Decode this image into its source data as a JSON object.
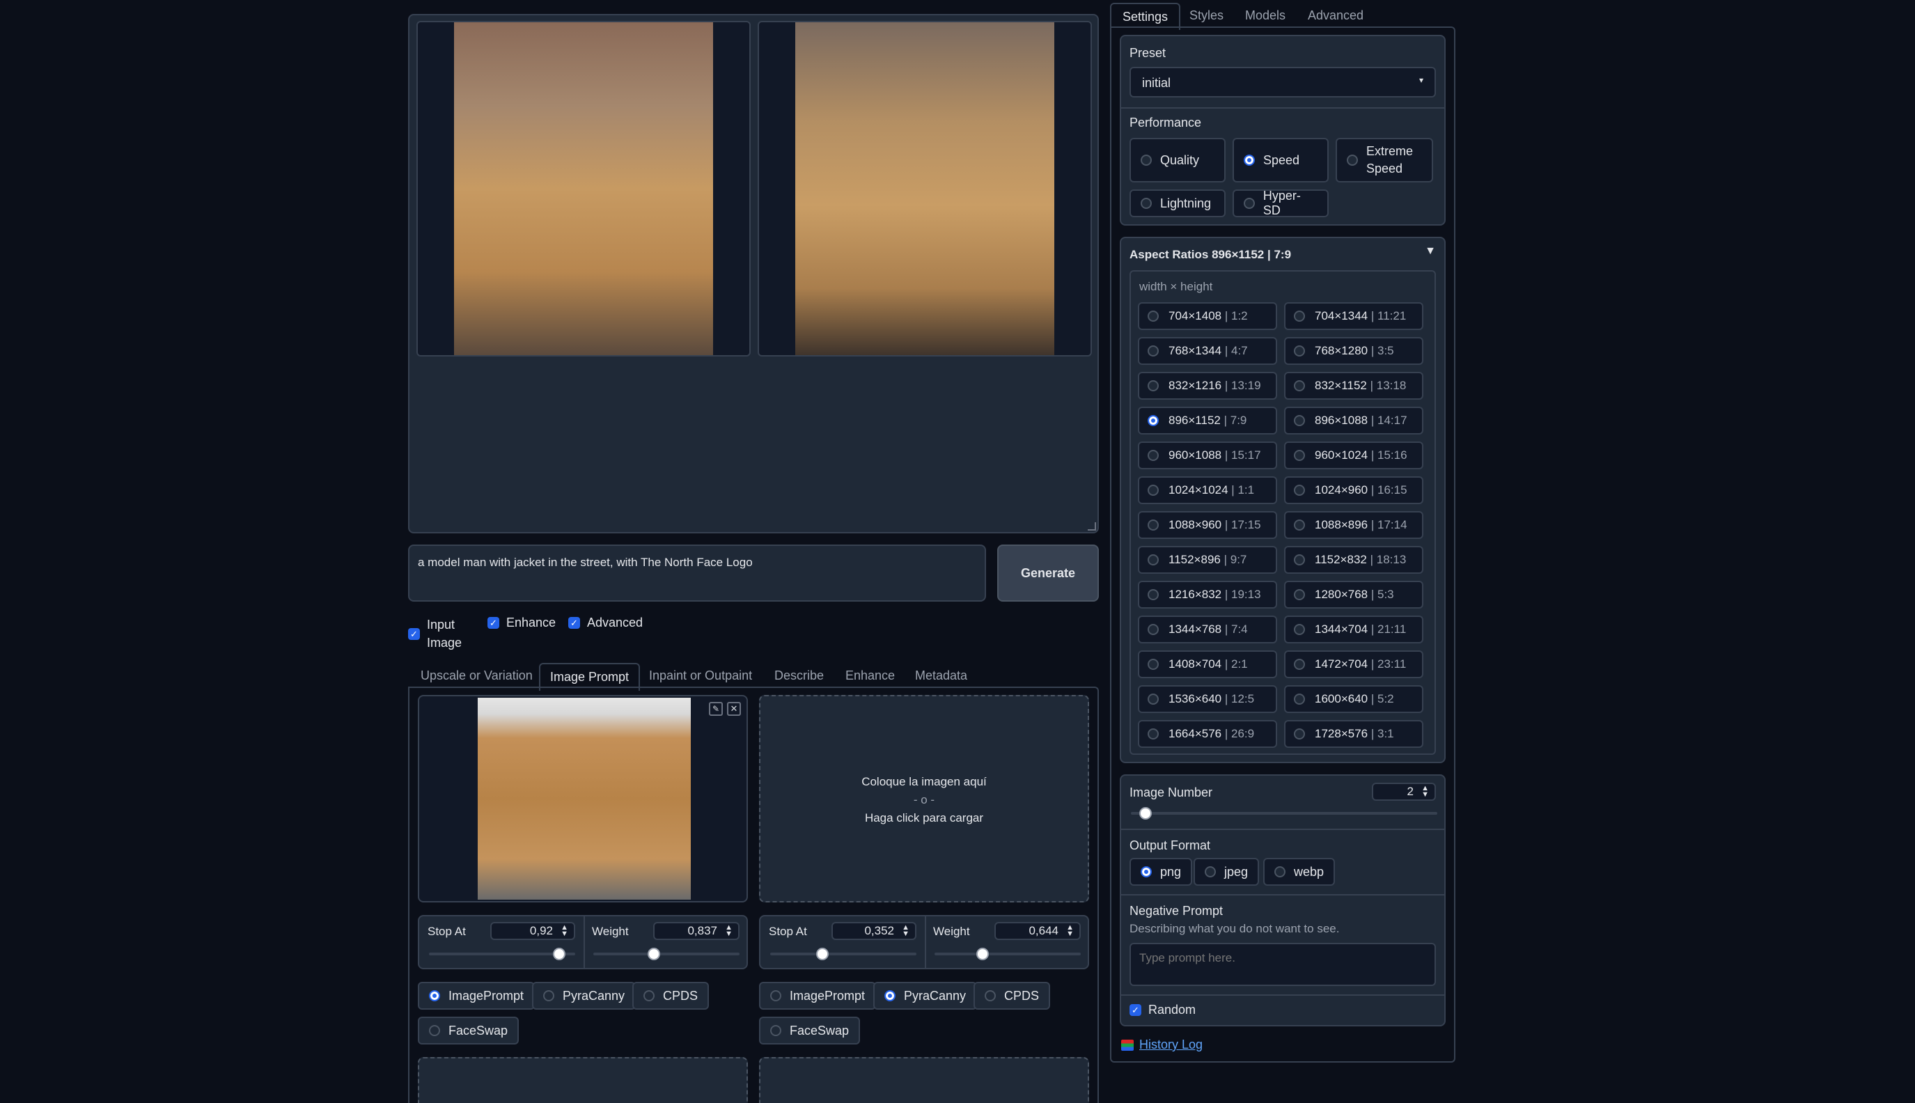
{
  "gallery": {
    "image1_alt": "",
    "image2_alt": ""
  },
  "prompt": {
    "value": "a  model man with jacket  in the street, with The North Face Logo",
    "generate_label": "Generate"
  },
  "toggles": {
    "input_image_line1": "Input",
    "input_image_line2": "Image",
    "enhance": "Enhance",
    "advanced": "Advanced"
  },
  "input_tabs": [
    "Upscale or Variation",
    "Image Prompt",
    "Inpaint or Outpaint",
    "Describe",
    "Enhance",
    "Metadata"
  ],
  "image_prompt": {
    "drop_line1": "Coloque la imagen aquí",
    "drop_line2": "- o -",
    "drop_line3": "Haga click para cargar",
    "slot1": {
      "stop_label": "Stop At",
      "stop_value": "0,92",
      "stop_fraction": 0.92,
      "weight_label": "Weight",
      "weight_value": "0,837",
      "weight_fraction": 0.4185
    },
    "slot2": {
      "stop_label": "Stop At",
      "stop_value": "0,352",
      "stop_fraction": 0.352,
      "weight_label": "Weight",
      "weight_value": "0,644",
      "weight_fraction": 0.322
    },
    "types": [
      "ImagePrompt",
      "PyraCanny",
      "CPDS",
      "FaceSwap"
    ],
    "slot1_selected": "ImagePrompt",
    "slot2_selected": "PyraCanny"
  },
  "settings_tabs": [
    "Settings",
    "Styles",
    "Models",
    "Advanced"
  ],
  "preset": {
    "label": "Preset",
    "value": "initial"
  },
  "performance": {
    "label": "Performance",
    "options": [
      "Quality",
      "Speed",
      "Extreme",
      "Speed",
      "Lightning",
      "Hyper-SD"
    ],
    "selected": "Speed"
  },
  "aspect": {
    "header": "Aspect Ratios 896×1152 | 7:9",
    "hint": "width × height",
    "options": [
      [
        "704×1408",
        "1:2"
      ],
      [
        "704×1344",
        "11:21"
      ],
      [
        "768×1344",
        "4:7"
      ],
      [
        "768×1280",
        "3:5"
      ],
      [
        "832×1216",
        "13:19"
      ],
      [
        "832×1152",
        "13:18"
      ],
      [
        "896×1152",
        "7:9"
      ],
      [
        "896×1088",
        "14:17"
      ],
      [
        "960×1088",
        "15:17"
      ],
      [
        "960×1024",
        "15:16"
      ],
      [
        "1024×1024",
        "1:1"
      ],
      [
        "1024×960",
        "16:15"
      ],
      [
        "1088×960",
        "17:15"
      ],
      [
        "1088×896",
        "17:14"
      ],
      [
        "1152×896",
        "9:7"
      ],
      [
        "1152×832",
        "18:13"
      ],
      [
        "1216×832",
        "19:13"
      ],
      [
        "1280×768",
        "5:3"
      ],
      [
        "1344×768",
        "7:4"
      ],
      [
        "1344×704",
        "21:11"
      ],
      [
        "1408×704",
        "2:1"
      ],
      [
        "1472×704",
        "23:11"
      ],
      [
        "1536×640",
        "12:5"
      ],
      [
        "1600×640",
        "5:2"
      ],
      [
        "1664×576",
        "26:9"
      ],
      [
        "1728×576",
        "3:1"
      ]
    ],
    "selected": "896×1152"
  },
  "image_number": {
    "label": "Image Number",
    "value": "2",
    "fraction": 0.03
  },
  "output_format": {
    "label": "Output Format",
    "options": [
      "png",
      "jpeg",
      "webp"
    ],
    "selected": "png"
  },
  "negative_prompt": {
    "label": "Negative Prompt",
    "info": "Describing what you do not want to see.",
    "placeholder": "Type prompt here."
  },
  "random": {
    "label": "Random"
  },
  "history": {
    "label": "History Log"
  },
  "colors": {
    "accent": "#2563eb",
    "bg": "#0b0f19",
    "panel": "#1f2937",
    "border": "#374151"
  }
}
